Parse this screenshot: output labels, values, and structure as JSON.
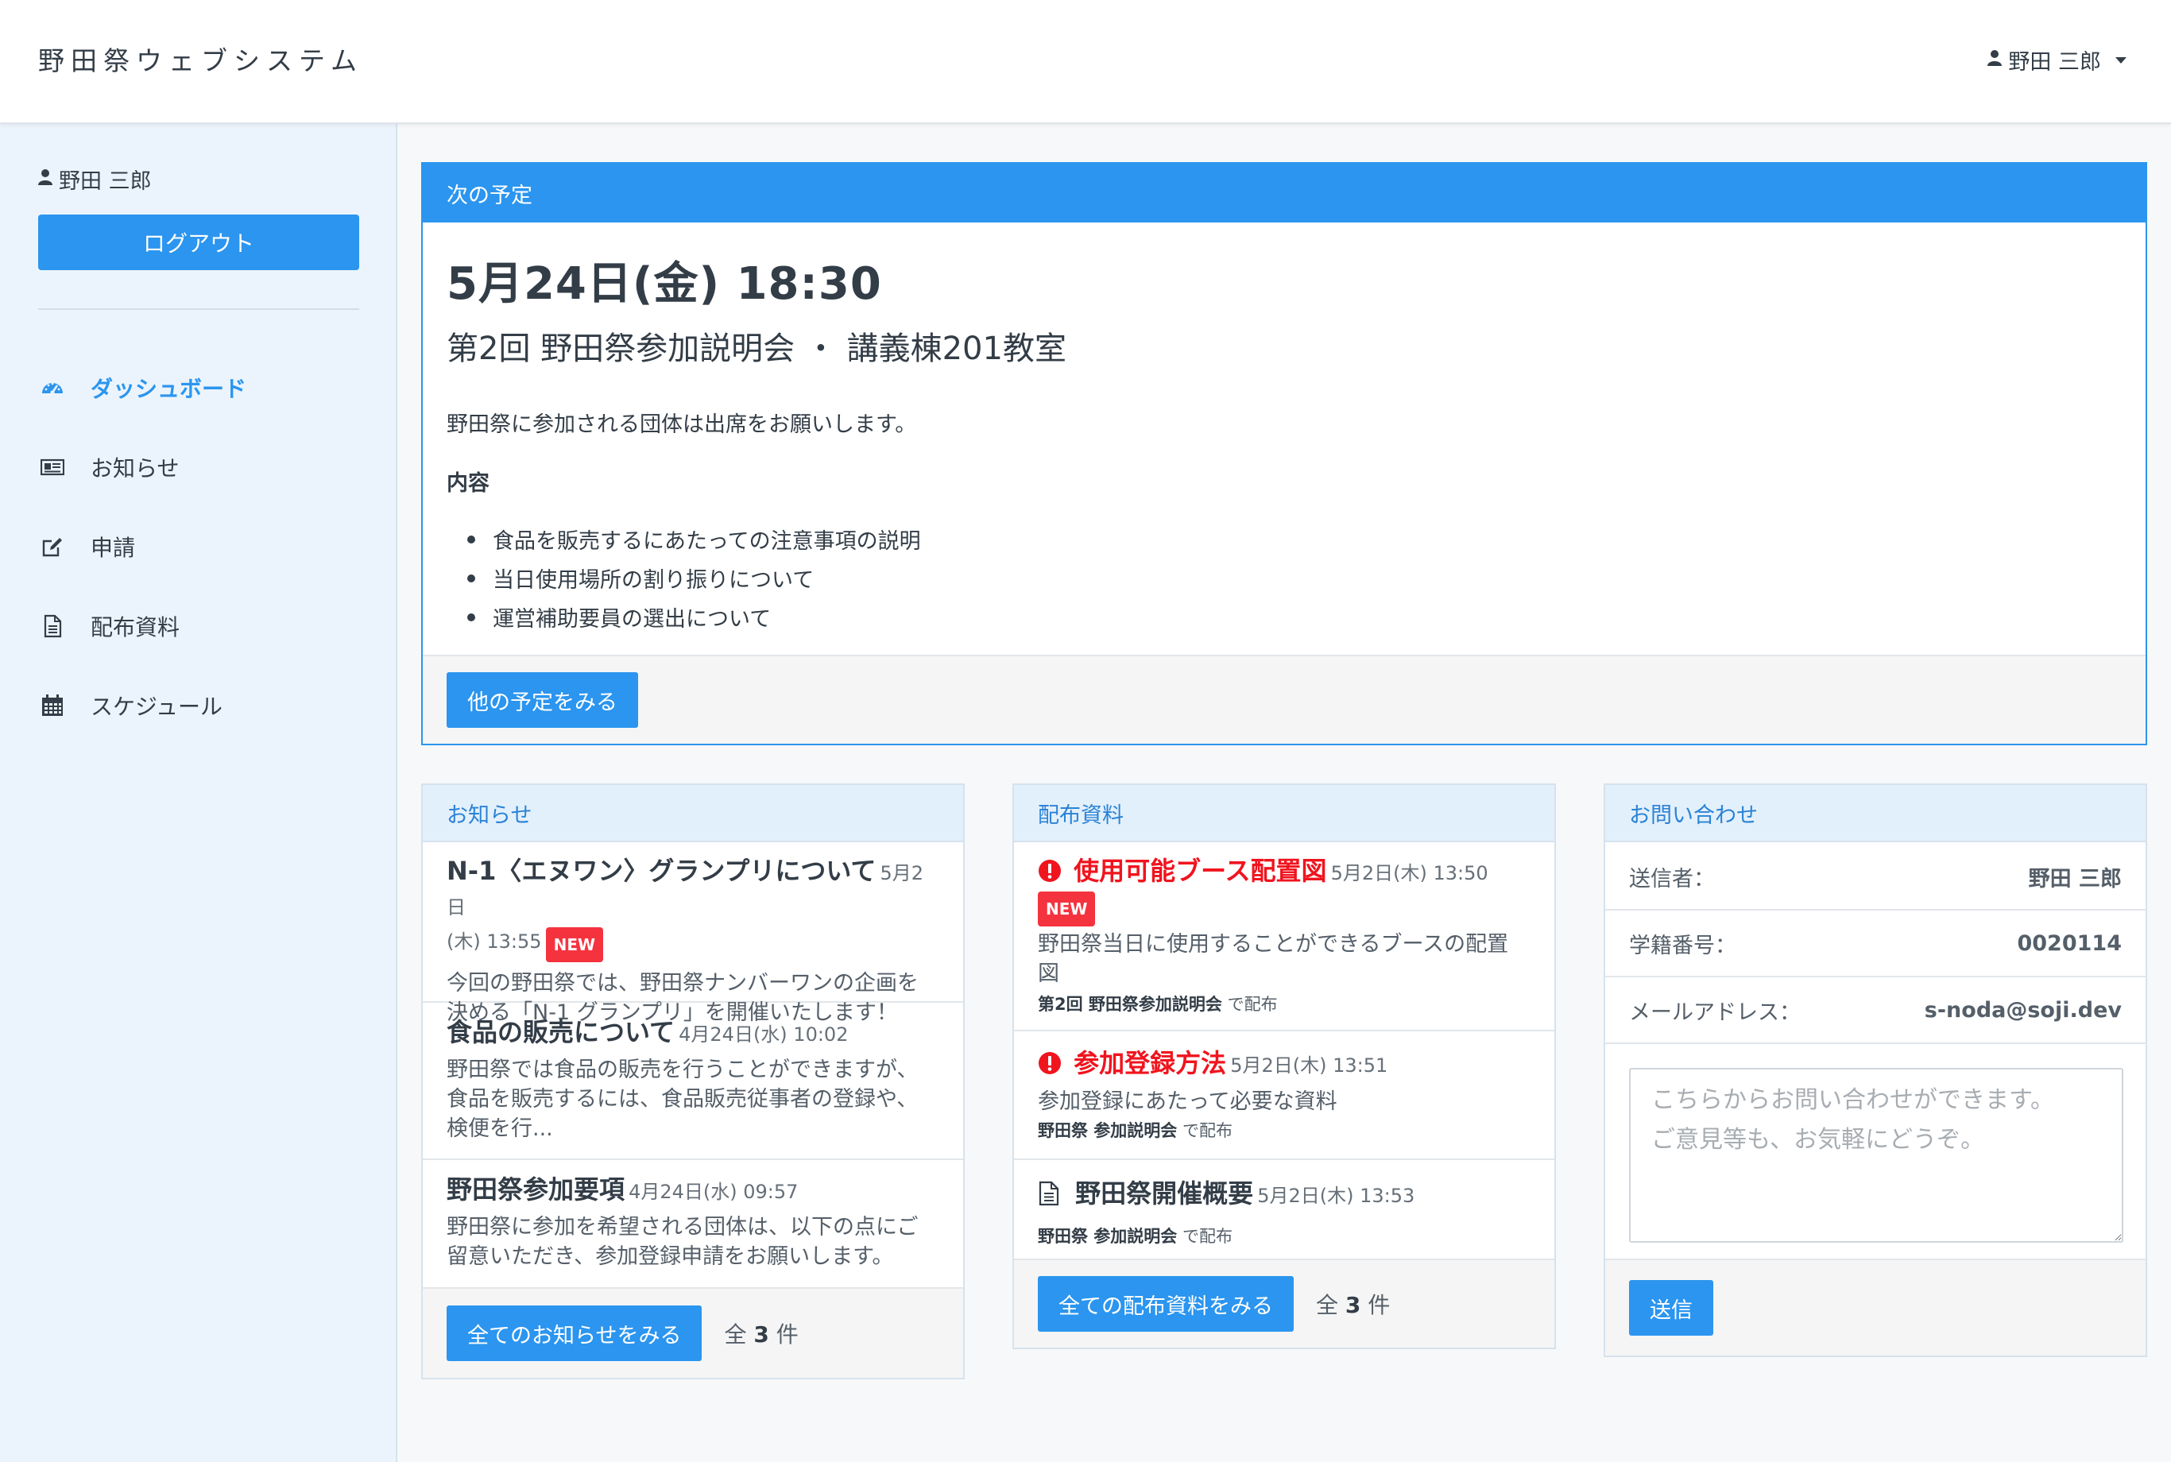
{
  "header": {
    "brand": "野田祭ウェブシステム",
    "user_name": "野田 三郎"
  },
  "sidebar": {
    "user_name": "野田 三郎",
    "logout_label": "ログアウト",
    "nav": [
      {
        "label": "ダッシュボード",
        "icon": "dashboard-icon",
        "active": true
      },
      {
        "label": "お知らせ",
        "icon": "newspaper-icon",
        "active": false
      },
      {
        "label": "申請",
        "icon": "edit-icon",
        "active": false
      },
      {
        "label": "配布資料",
        "icon": "document-icon",
        "active": false
      },
      {
        "label": "スケジュール",
        "icon": "calendar-icon",
        "active": false
      }
    ]
  },
  "next_schedule": {
    "heading": "次の予定",
    "date": "5月24日(金) 18:30",
    "title": "第2回 野田祭参加説明会 ・ 講義棟201教室",
    "description": "野田祭に参加される団体は出席をお願いします。",
    "contents_label": "内容",
    "contents": [
      "食品を販売するにあたっての注意事項の説明",
      "当日使用場所の割り振りについて",
      "運営補助要員の選出について"
    ],
    "button_label": "他の予定をみる"
  },
  "news": {
    "heading": "お知らせ",
    "items": [
      {
        "title": "N-1〈エヌワン〉グランプリについて",
        "meta_line1": "5月2日",
        "meta_line2": "(木) 13:55",
        "badge": "NEW",
        "body_line1": "今回の野田祭では、野田祭ナンバーワンの企画を",
        "body_line2": "決める「N-1 グランプリ」を開催いたします！"
      },
      {
        "title": "食品の販売について",
        "meta": "4月24日(水) 10:02",
        "body_line1": "野田祭では食品の販売を行うことができますが、",
        "body_line2": "食品を販売するには、食品販売従事者の登録や、",
        "body_line3": "検便を行..."
      },
      {
        "title": "野田祭参加要項",
        "meta": "4月24日(水) 09:57",
        "body_line1": "野田祭に参加を希望される団体は、以下の点にご",
        "body_line2": "留意いただき、参加登録申請をお願いします。"
      }
    ],
    "button_label": "全てのお知らせをみる",
    "count_prefix": "全",
    "count": "3",
    "count_suffix": "件"
  },
  "docs": {
    "heading": "配布資料",
    "items": [
      {
        "title": "使用可能ブース配置図",
        "meta": "5月2日(木) 13:50",
        "badge": "NEW",
        "important": true,
        "body_line1": "野田祭当日に使用することができるブースの配置",
        "body_line2": "図",
        "source": "第2回 野田祭参加説明会",
        "source_suffix": "で配布"
      },
      {
        "title": "参加登録方法",
        "meta": "5月2日(木) 13:51",
        "important": true,
        "body_line1": "参加登録にあたって必要な資料",
        "source": "野田祭 参加説明会",
        "source_suffix": "で配布"
      },
      {
        "title": "野田祭開催概要",
        "meta": "5月2日(木) 13:53",
        "important": false,
        "source": "野田祭 参加説明会",
        "source_suffix": "で配布"
      }
    ],
    "button_label": "全ての配布資料をみる",
    "count_prefix": "全",
    "count": "3",
    "count_suffix": "件"
  },
  "inquiry": {
    "heading": "お問い合わせ",
    "sender_label": "送信者：",
    "sender_value": "野田 三郎",
    "student_id_label": "学籍番号：",
    "student_id_value": "0020114",
    "email_label": "メールアドレス：",
    "email_value": "s-noda@soji.dev",
    "placeholder": "こちらからお問い合わせができます。\nご意見等も、お気軽にどうぞ。",
    "submit_label": "送信"
  },
  "colors": {
    "accent": "#2b95ef",
    "sidebar_bg": "#ebf4fc",
    "danger": "#f0141e",
    "badge": "#f5333f"
  }
}
